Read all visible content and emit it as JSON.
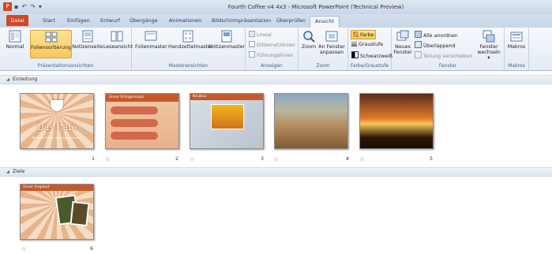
{
  "window": {
    "title": "Fourth Coffee v4 4x3 - Microsoft PowerPoint (Technical Preview)",
    "app_icon_letter": "P",
    "qat_icons": [
      "save-icon",
      "undo-icon",
      "redo-icon",
      "customize-icon"
    ]
  },
  "tabs": [
    {
      "label": "Datei"
    },
    {
      "label": "Start"
    },
    {
      "label": "Einfügen"
    },
    {
      "label": "Entwurf"
    },
    {
      "label": "Übergänge"
    },
    {
      "label": "Animationen"
    },
    {
      "label": "Bildschirmpräsentation"
    },
    {
      "label": "Überprüfen"
    },
    {
      "label": "Ansicht"
    }
  ],
  "ribbon": {
    "groups": {
      "presentation_views": "Präsentationsansichten",
      "master_views": "Masteransichten",
      "show": "Anzeigen",
      "zoom": "Zoom",
      "color": "Farbe/Graustufe",
      "window": "Fenster",
      "macros": "Makros"
    },
    "buttons": {
      "normal": "Normal",
      "slide_sorter": "Foliensortierung",
      "notes_page": "Notizenseite",
      "reading_view": "Leseansicht",
      "slide_master": "Folienmaster",
      "handout_master": "Handzettelmaster",
      "notes_master": "Notizenmaster",
      "ruler": "Lineal",
      "gridlines": "Gitternetzlinien",
      "guides": "Führungslinien",
      "zoom": "Zoom",
      "fit_window_1": "An Fenster",
      "fit_window_2": "anpassen",
      "color": "Farbe",
      "grayscale": "Graustufe",
      "black_white": "Schwarzweiß",
      "new_window_1": "Neues",
      "new_window_2": "Fenster",
      "arrange_all": "Alle anordnen",
      "cascade": "Überlappend",
      "move_split": "Teilung verschieben",
      "switch_windows_1": "Fenster",
      "switch_windows_2": "wechseln",
      "macros": "Makros"
    }
  },
  "sections": [
    {
      "name": "Einleitung",
      "slides": [
        {
          "number": "1",
          "title": "Das Café",
          "subtitle": "Wir laden Sie ein zu unserer neuen..."
        },
        {
          "number": "2",
          "title": "Unser Erfolgsrezept"
        },
        {
          "number": "3",
          "title": "Neubau"
        },
        {
          "number": "4"
        },
        {
          "number": "5"
        }
      ]
    },
    {
      "name": "Ziele",
      "slides": [
        {
          "number": "6",
          "title": "Unser Angebot"
        }
      ]
    }
  ],
  "colors": {
    "file_tab": "#d24726",
    "active_button": "#f8c85a",
    "section_bar": "#dde5f0"
  }
}
